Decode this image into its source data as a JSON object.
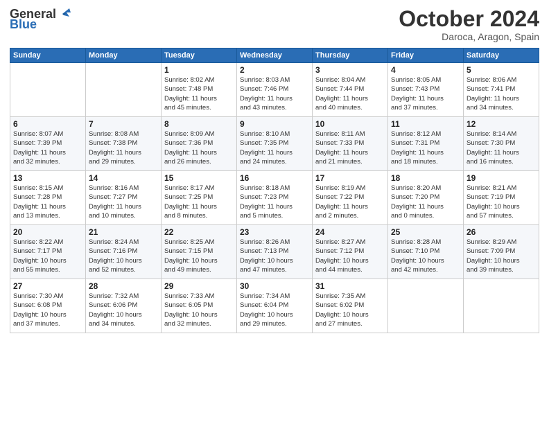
{
  "logo": {
    "text_general": "General",
    "text_blue": "Blue"
  },
  "header": {
    "month": "October 2024",
    "location": "Daroca, Aragon, Spain"
  },
  "weekdays": [
    "Sunday",
    "Monday",
    "Tuesday",
    "Wednesday",
    "Thursday",
    "Friday",
    "Saturday"
  ],
  "weeks": [
    [
      {
        "day": "",
        "info": ""
      },
      {
        "day": "",
        "info": ""
      },
      {
        "day": "1",
        "info": "Sunrise: 8:02 AM\nSunset: 7:48 PM\nDaylight: 11 hours\nand 45 minutes."
      },
      {
        "day": "2",
        "info": "Sunrise: 8:03 AM\nSunset: 7:46 PM\nDaylight: 11 hours\nand 43 minutes."
      },
      {
        "day": "3",
        "info": "Sunrise: 8:04 AM\nSunset: 7:44 PM\nDaylight: 11 hours\nand 40 minutes."
      },
      {
        "day": "4",
        "info": "Sunrise: 8:05 AM\nSunset: 7:43 PM\nDaylight: 11 hours\nand 37 minutes."
      },
      {
        "day": "5",
        "info": "Sunrise: 8:06 AM\nSunset: 7:41 PM\nDaylight: 11 hours\nand 34 minutes."
      }
    ],
    [
      {
        "day": "6",
        "info": "Sunrise: 8:07 AM\nSunset: 7:39 PM\nDaylight: 11 hours\nand 32 minutes."
      },
      {
        "day": "7",
        "info": "Sunrise: 8:08 AM\nSunset: 7:38 PM\nDaylight: 11 hours\nand 29 minutes."
      },
      {
        "day": "8",
        "info": "Sunrise: 8:09 AM\nSunset: 7:36 PM\nDaylight: 11 hours\nand 26 minutes."
      },
      {
        "day": "9",
        "info": "Sunrise: 8:10 AM\nSunset: 7:35 PM\nDaylight: 11 hours\nand 24 minutes."
      },
      {
        "day": "10",
        "info": "Sunrise: 8:11 AM\nSunset: 7:33 PM\nDaylight: 11 hours\nand 21 minutes."
      },
      {
        "day": "11",
        "info": "Sunrise: 8:12 AM\nSunset: 7:31 PM\nDaylight: 11 hours\nand 18 minutes."
      },
      {
        "day": "12",
        "info": "Sunrise: 8:14 AM\nSunset: 7:30 PM\nDaylight: 11 hours\nand 16 minutes."
      }
    ],
    [
      {
        "day": "13",
        "info": "Sunrise: 8:15 AM\nSunset: 7:28 PM\nDaylight: 11 hours\nand 13 minutes."
      },
      {
        "day": "14",
        "info": "Sunrise: 8:16 AM\nSunset: 7:27 PM\nDaylight: 11 hours\nand 10 minutes."
      },
      {
        "day": "15",
        "info": "Sunrise: 8:17 AM\nSunset: 7:25 PM\nDaylight: 11 hours\nand 8 minutes."
      },
      {
        "day": "16",
        "info": "Sunrise: 8:18 AM\nSunset: 7:23 PM\nDaylight: 11 hours\nand 5 minutes."
      },
      {
        "day": "17",
        "info": "Sunrise: 8:19 AM\nSunset: 7:22 PM\nDaylight: 11 hours\nand 2 minutes."
      },
      {
        "day": "18",
        "info": "Sunrise: 8:20 AM\nSunset: 7:20 PM\nDaylight: 11 hours\nand 0 minutes."
      },
      {
        "day": "19",
        "info": "Sunrise: 8:21 AM\nSunset: 7:19 PM\nDaylight: 10 hours\nand 57 minutes."
      }
    ],
    [
      {
        "day": "20",
        "info": "Sunrise: 8:22 AM\nSunset: 7:17 PM\nDaylight: 10 hours\nand 55 minutes."
      },
      {
        "day": "21",
        "info": "Sunrise: 8:24 AM\nSunset: 7:16 PM\nDaylight: 10 hours\nand 52 minutes."
      },
      {
        "day": "22",
        "info": "Sunrise: 8:25 AM\nSunset: 7:15 PM\nDaylight: 10 hours\nand 49 minutes."
      },
      {
        "day": "23",
        "info": "Sunrise: 8:26 AM\nSunset: 7:13 PM\nDaylight: 10 hours\nand 47 minutes."
      },
      {
        "day": "24",
        "info": "Sunrise: 8:27 AM\nSunset: 7:12 PM\nDaylight: 10 hours\nand 44 minutes."
      },
      {
        "day": "25",
        "info": "Sunrise: 8:28 AM\nSunset: 7:10 PM\nDaylight: 10 hours\nand 42 minutes."
      },
      {
        "day": "26",
        "info": "Sunrise: 8:29 AM\nSunset: 7:09 PM\nDaylight: 10 hours\nand 39 minutes."
      }
    ],
    [
      {
        "day": "27",
        "info": "Sunrise: 7:30 AM\nSunset: 6:08 PM\nDaylight: 10 hours\nand 37 minutes."
      },
      {
        "day": "28",
        "info": "Sunrise: 7:32 AM\nSunset: 6:06 PM\nDaylight: 10 hours\nand 34 minutes."
      },
      {
        "day": "29",
        "info": "Sunrise: 7:33 AM\nSunset: 6:05 PM\nDaylight: 10 hours\nand 32 minutes."
      },
      {
        "day": "30",
        "info": "Sunrise: 7:34 AM\nSunset: 6:04 PM\nDaylight: 10 hours\nand 29 minutes."
      },
      {
        "day": "31",
        "info": "Sunrise: 7:35 AM\nSunset: 6:02 PM\nDaylight: 10 hours\nand 27 minutes."
      },
      {
        "day": "",
        "info": ""
      },
      {
        "day": "",
        "info": ""
      }
    ]
  ]
}
